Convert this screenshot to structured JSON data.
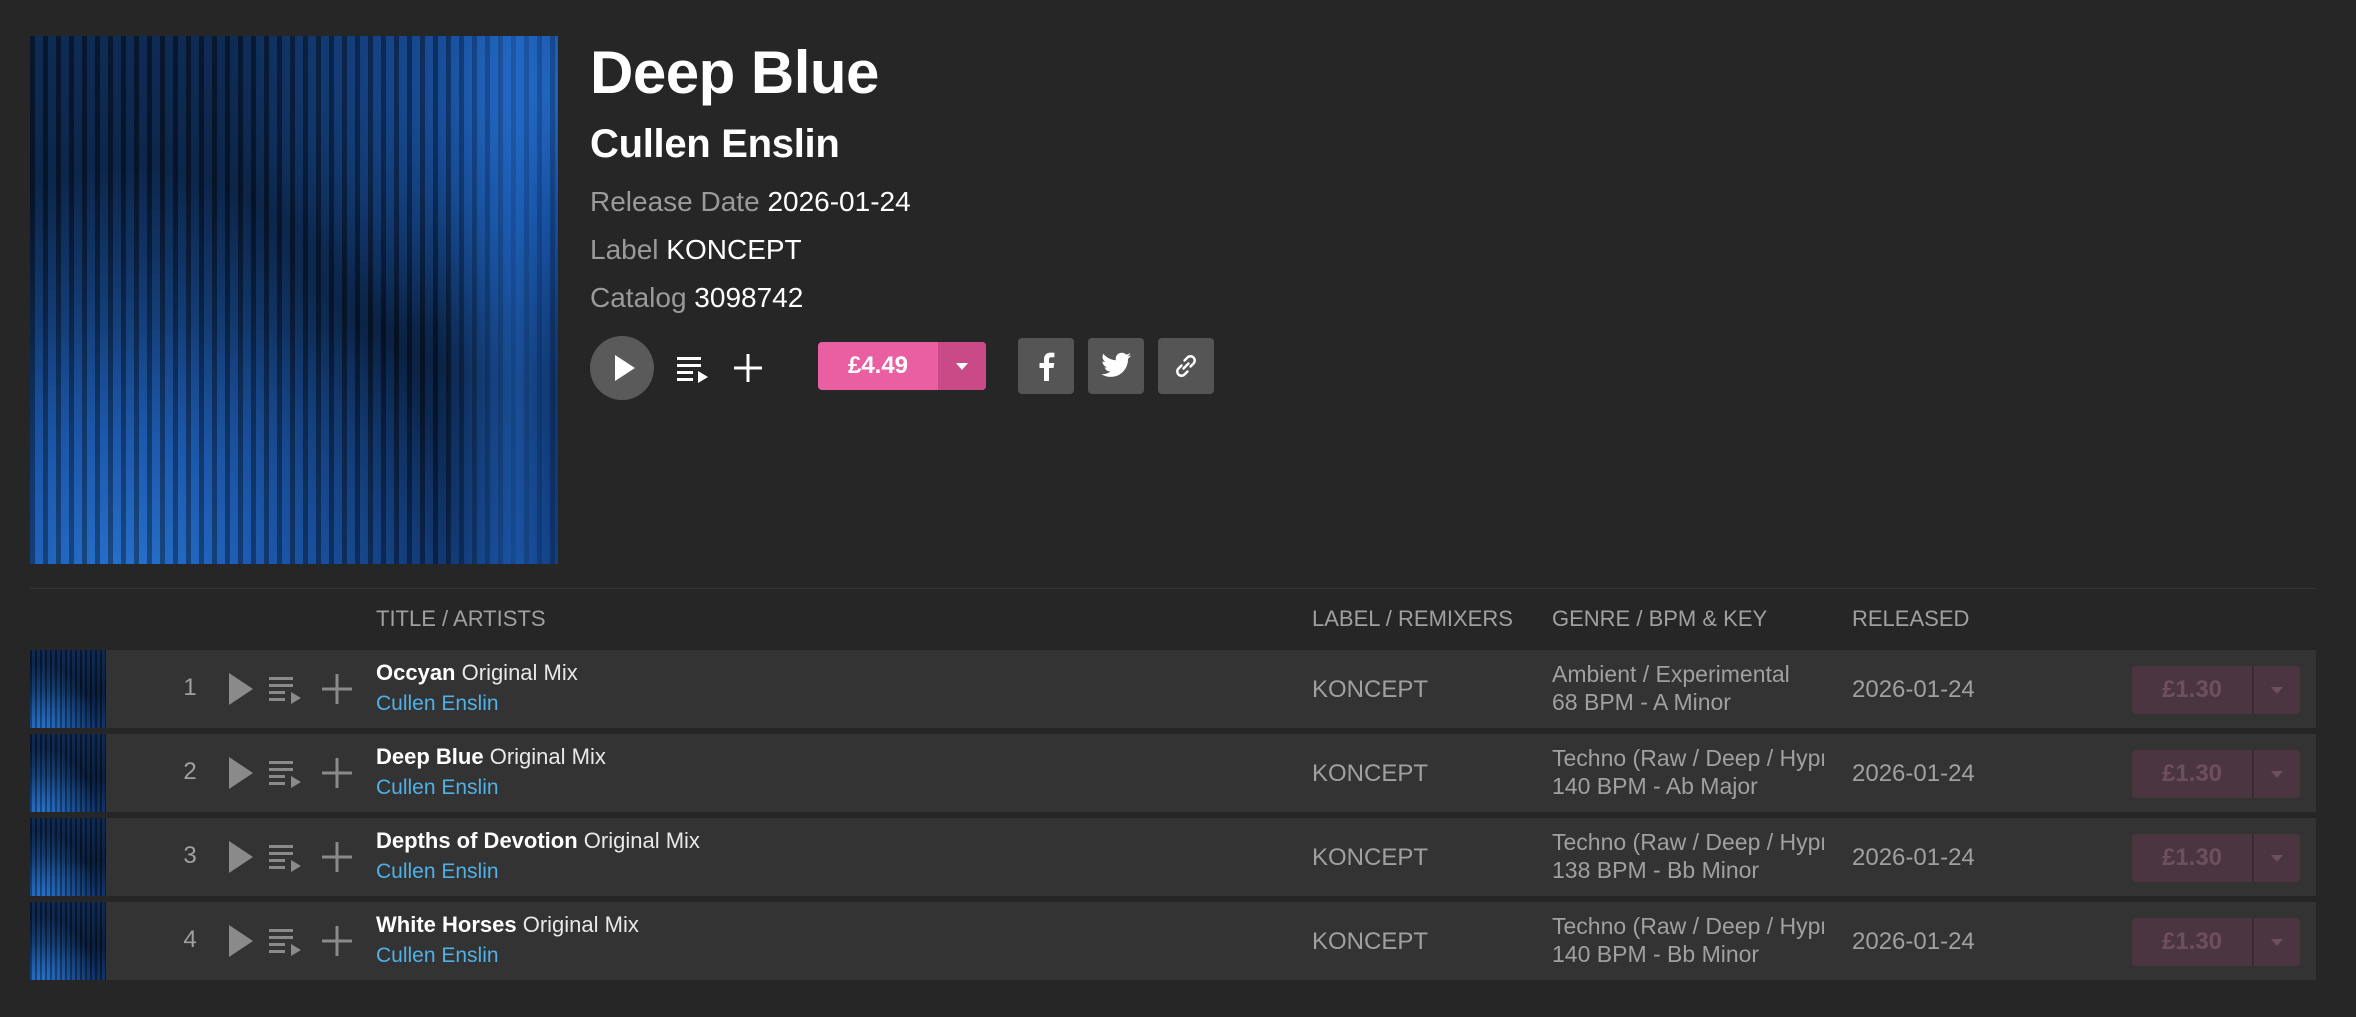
{
  "release": {
    "title": "Deep Blue",
    "artist": "Cullen Enslin",
    "release_date_key": "Release Date",
    "release_date": "2026-01-24",
    "label_key": "Label",
    "label": "KONCEPT",
    "catalog_key": "Catalog",
    "catalog": "3098742",
    "price": "£4.49",
    "accent_color": "#e95fa2"
  },
  "table": {
    "headers": {
      "title": "TITLE / ARTISTS",
      "label": "LABEL / REMIXERS",
      "genre": "GENRE / BPM & KEY",
      "released": "RELEASED"
    },
    "tracks": [
      {
        "num": "1",
        "title": "Occyan",
        "mix": "Original Mix",
        "artist": "Cullen Enslin",
        "label": "KONCEPT",
        "genre": "Ambient / Experimental",
        "bpm_key": "68 BPM - A Minor",
        "released": "2026-01-24",
        "price": "£1.30"
      },
      {
        "num": "2",
        "title": "Deep Blue",
        "mix": "Original Mix",
        "artist": "Cullen Enslin",
        "label": "KONCEPT",
        "genre": "Techno (Raw / Deep / Hypnotic)",
        "bpm_key": "140 BPM - Ab Major",
        "released": "2026-01-24",
        "price": "£1.30"
      },
      {
        "num": "3",
        "title": "Depths of Devotion",
        "mix": "Original Mix",
        "artist": "Cullen Enslin",
        "label": "KONCEPT",
        "genre": "Techno (Raw / Deep / Hypnotic)",
        "bpm_key": "138 BPM - Bb Minor",
        "released": "2026-01-24",
        "price": "£1.30"
      },
      {
        "num": "4",
        "title": "White Horses",
        "mix": "Original Mix",
        "artist": "Cullen Enslin",
        "label": "KONCEPT",
        "genre": "Techno (Raw / Deep / Hypnotic)",
        "bpm_key": "140 BPM - Bb Minor",
        "released": "2026-01-24",
        "price": "£1.30"
      }
    ]
  },
  "icons": {
    "play": "play-icon",
    "queue": "add-to-queue-icon",
    "add": "plus-icon",
    "facebook": "facebook-icon",
    "twitter": "twitter-icon",
    "link": "link-icon",
    "caret": "chevron-down-icon"
  }
}
